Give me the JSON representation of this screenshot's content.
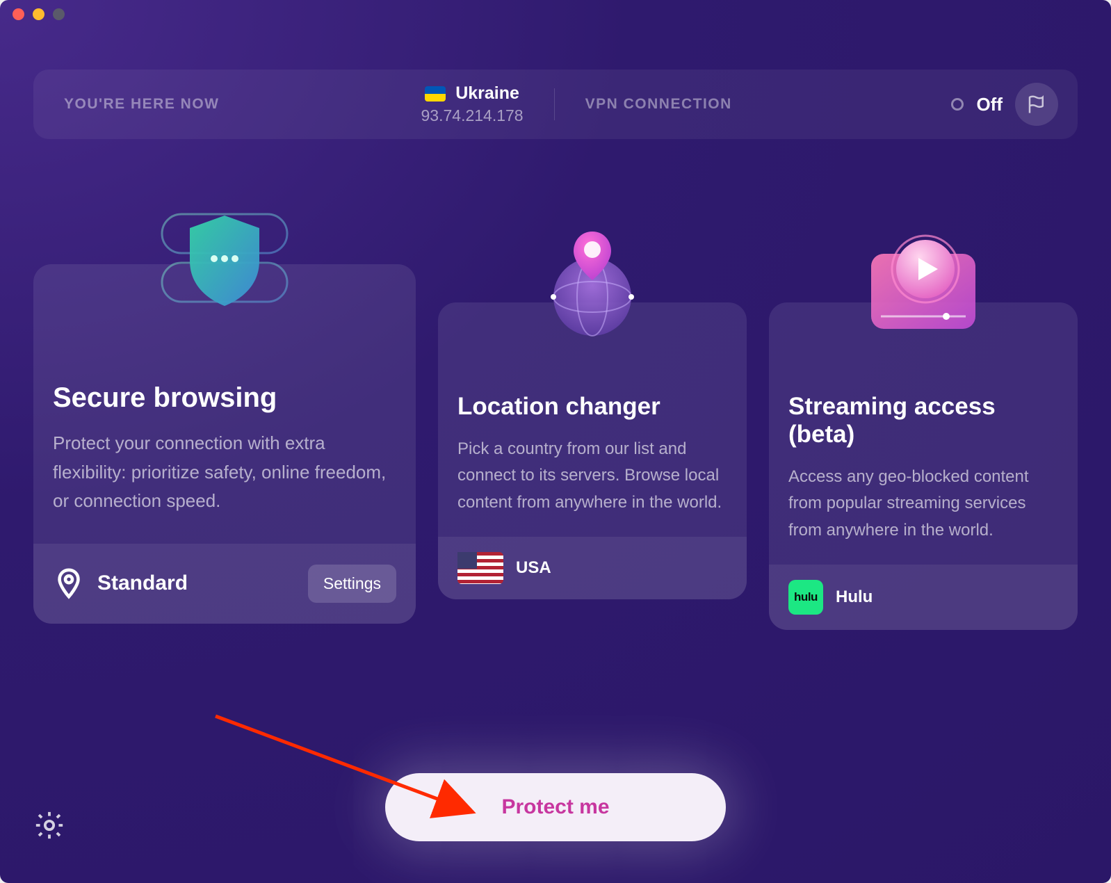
{
  "window": {
    "here_now_label": "YOU'RE HERE NOW",
    "country": "Ukraine",
    "ip": "93.74.214.178",
    "vpn_label": "VPN CONNECTION",
    "status": "Off",
    "colors": {
      "accent": "#c7369f",
      "bg_start": "#472a8a",
      "bg_end": "#2b1768"
    }
  },
  "cards": {
    "secure": {
      "icon": "shield-stars-icon",
      "title": "Secure browsing",
      "desc": "Protect your connection with extra flexibility: prioritize safety, online freedom, or connection speed.",
      "footer_icon": "pin-icon",
      "footer_label": "Standard",
      "settings_label": "Settings"
    },
    "location": {
      "icon": "globe-pin-icon",
      "title": "Location changer",
      "desc": "Pick a country from our list and connect to its servers. Browse local content from anywhere in the world.",
      "footer_label": "USA"
    },
    "streaming": {
      "icon": "play-card-icon",
      "title": "Streaming access (beta)",
      "desc": "Access any geo-blocked content from popular streaming services from anywhere in the world.",
      "footer_badge": "hulu",
      "footer_label": "Hulu"
    }
  },
  "bottom": {
    "protect_label": "Protect me"
  }
}
